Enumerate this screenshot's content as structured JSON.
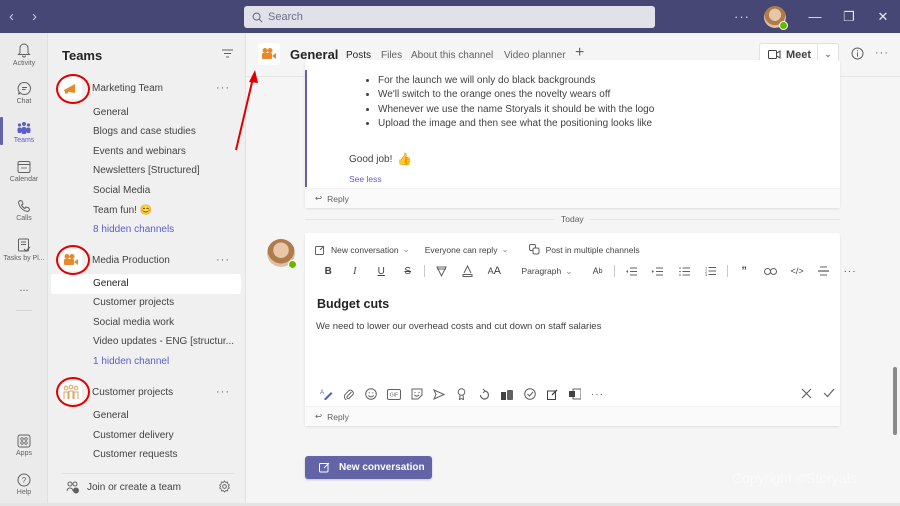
{
  "titlebar": {
    "back_icon": "chevron-left-icon",
    "forward_icon": "chevron-right-icon",
    "search_placeholder": "Search",
    "more_icon": "more-icon",
    "window_controls": [
      "minimize",
      "maximize",
      "close"
    ]
  },
  "rail": {
    "items": [
      {
        "label": "Activity",
        "icon": "bell-icon"
      },
      {
        "label": "Chat",
        "icon": "chat-icon"
      },
      {
        "label": "Teams",
        "icon": "teams-icon",
        "active": true
      },
      {
        "label": "Calendar",
        "icon": "calendar-icon"
      },
      {
        "label": "Calls",
        "icon": "phone-icon"
      },
      {
        "label": "Tasks by Pl...",
        "icon": "tasks-icon"
      },
      {
        "label": "...",
        "icon": "more-icon"
      }
    ],
    "bottom": [
      {
        "label": "Apps",
        "icon": "apps-icon"
      },
      {
        "label": "Help",
        "icon": "help-icon"
      }
    ]
  },
  "panel": {
    "title": "Teams",
    "teams": [
      {
        "name": "Marketing Team",
        "icon": "megaphone-icon",
        "channels": [
          "General",
          "Blogs and case studies",
          "Events and webinars",
          "Newsletters [Structured]",
          "Social Media",
          "Team fun! 😊"
        ],
        "hidden": "8 hidden channels"
      },
      {
        "name": "Media Production",
        "icon": "video-camera-icon",
        "channels": [
          "General",
          "Customer projects",
          "Social media work",
          "Video updates - ENG [structur..."
        ],
        "hidden": "1 hidden channel",
        "active_channel": "General"
      },
      {
        "name": "Customer projects",
        "icon": "people-icon",
        "channels": [
          "General",
          "Customer delivery",
          "Customer requests"
        ]
      }
    ],
    "join_label": "Join or create a team"
  },
  "header": {
    "channel": "General",
    "tabs": [
      "Posts",
      "Files",
      "About this channel",
      "Video planner"
    ],
    "active_tab": "Posts",
    "meet_label": "Meet"
  },
  "thread": {
    "bullets": [
      "For the launch we will only do black backgrounds",
      "We'll switch to the orange ones the novelty wears off",
      "Whenever we use the name Storyals it should be with the logo",
      "Upload the image and then see what the positioning looks like"
    ],
    "good_job": "Good job!",
    "see_less": "See less",
    "reply": "Reply"
  },
  "divider": "Today",
  "compose": {
    "conversation_type": "New conversation",
    "reply_setting": "Everyone can reply",
    "post_multiple": "Post in multiple channels",
    "paragraph": "Paragraph",
    "subject": "Budget cuts",
    "body": "We need to lower our overhead costs and cut down on staff salaries",
    "reply": "Reply"
  },
  "new_conversation_button": "New conversation",
  "watermark": "Copyright ©Storyals",
  "colors": {
    "brand": "#6264a7",
    "titlebar": "#464775",
    "team_icon_orange": "#e8892b",
    "annotation_red": "#e00000"
  }
}
